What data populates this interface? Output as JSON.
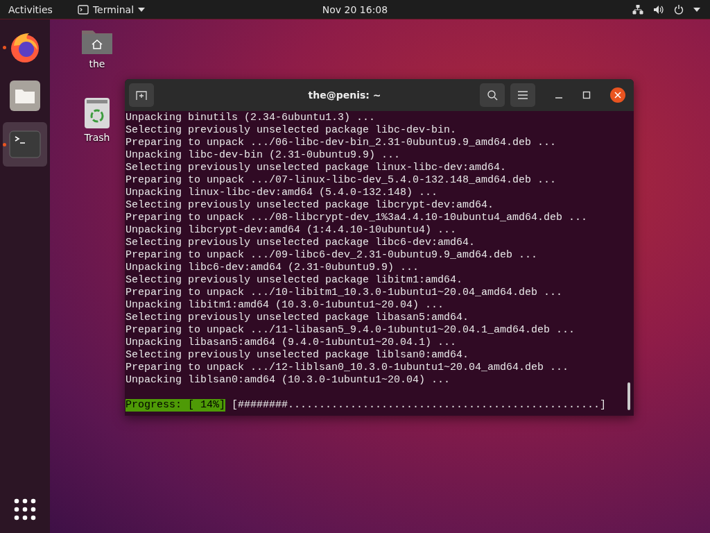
{
  "top_bar": {
    "activities": "Activities",
    "app_menu": "Terminal",
    "clock": "Nov 20  16:08"
  },
  "dock": {
    "items": [
      {
        "kind": "browser",
        "running": true,
        "selected": false
      },
      {
        "kind": "files",
        "running": false,
        "selected": false
      },
      {
        "kind": "terminal",
        "running": true,
        "selected": true
      }
    ]
  },
  "desktop_icons": [
    {
      "kind": "home",
      "label": "the"
    },
    {
      "kind": "trash",
      "label": "Trash"
    }
  ],
  "terminal": {
    "title": "the@penis: ~",
    "lines": [
      "Unpacking binutils (2.34-6ubuntu1.3) ...",
      "Selecting previously unselected package libc-dev-bin.",
      "Preparing to unpack .../06-libc-dev-bin_2.31-0ubuntu9.9_amd64.deb ...",
      "Unpacking libc-dev-bin (2.31-0ubuntu9.9) ...",
      "Selecting previously unselected package linux-libc-dev:amd64.",
      "Preparing to unpack .../07-linux-libc-dev_5.4.0-132.148_amd64.deb ...",
      "Unpacking linux-libc-dev:amd64 (5.4.0-132.148) ...",
      "Selecting previously unselected package libcrypt-dev:amd64.",
      "Preparing to unpack .../08-libcrypt-dev_1%3a4.4.10-10ubuntu4_amd64.deb ...",
      "Unpacking libcrypt-dev:amd64 (1:4.4.10-10ubuntu4) ...",
      "Selecting previously unselected package libc6-dev:amd64.",
      "Preparing to unpack .../09-libc6-dev_2.31-0ubuntu9.9_amd64.deb ...",
      "Unpacking libc6-dev:amd64 (2.31-0ubuntu9.9) ...",
      "Selecting previously unselected package libitm1:amd64.",
      "Preparing to unpack .../10-libitm1_10.3.0-1ubuntu1~20.04_amd64.deb ...",
      "Unpacking libitm1:amd64 (10.3.0-1ubuntu1~20.04) ...",
      "Selecting previously unselected package libasan5:amd64.",
      "Preparing to unpack .../11-libasan5_9.4.0-1ubuntu1~20.04.1_amd64.deb ...",
      "Unpacking libasan5:amd64 (9.4.0-1ubuntu1~20.04.1) ...",
      "Selecting previously unselected package liblsan0:amd64.",
      "Preparing to unpack .../12-liblsan0_10.3.0-1ubuntu1~20.04_amd64.deb ...",
      "Unpacking liblsan0:amd64 (10.3.0-1ubuntu1~20.04) ..."
    ],
    "progress_label": "Progress: [ 14%]",
    "progress_bar": "[########..................................................]"
  }
}
